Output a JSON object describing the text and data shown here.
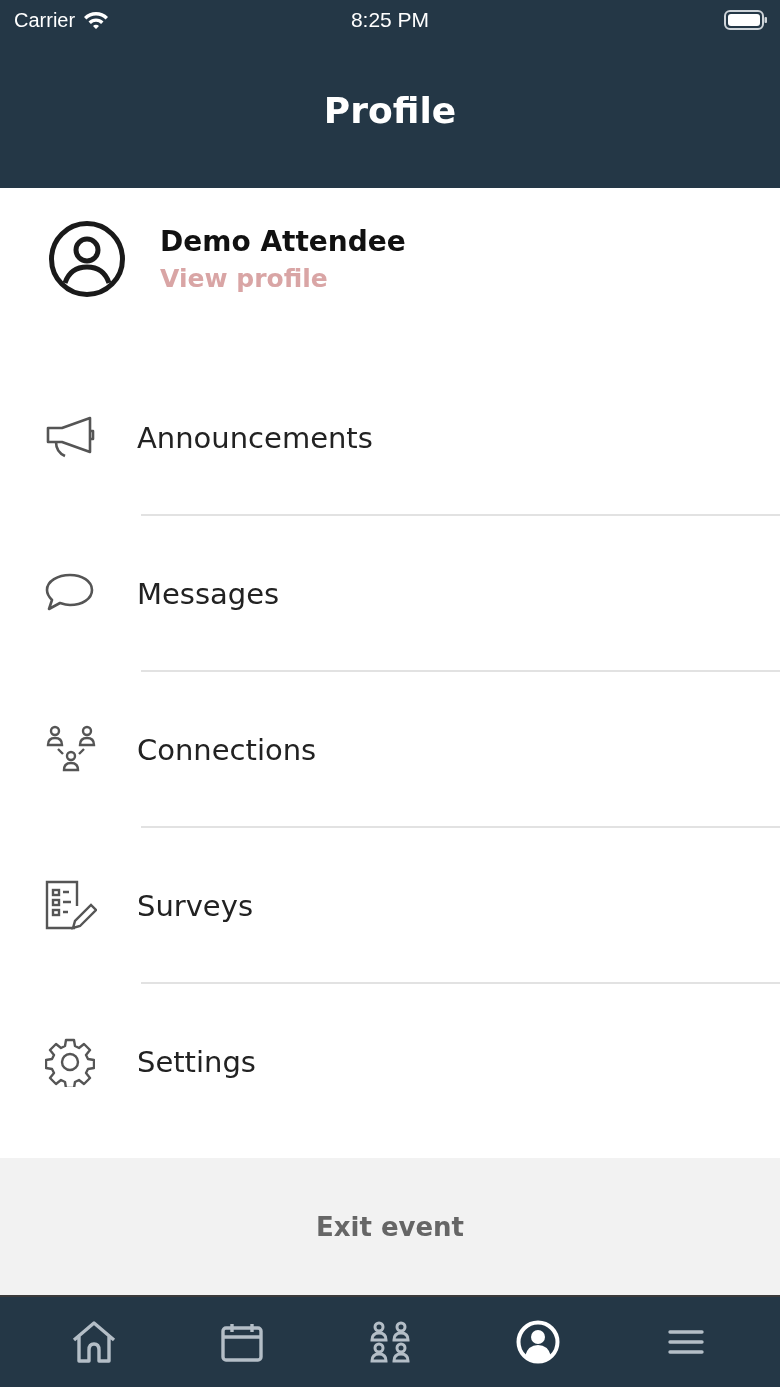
{
  "status_bar": {
    "carrier": "Carrier",
    "time": "8:25 PM"
  },
  "header": {
    "title": "Profile"
  },
  "profile": {
    "name": "Demo Attendee",
    "link": "View profile"
  },
  "menu": [
    {
      "kind": "announcements",
      "label": "Announcements"
    },
    {
      "kind": "messages",
      "label": "Messages"
    },
    {
      "kind": "connections",
      "label": "Connections"
    },
    {
      "kind": "surveys",
      "label": "Surveys"
    },
    {
      "kind": "settings",
      "label": "Settings"
    }
  ],
  "exit_button": "Exit event",
  "tab_bar": [
    {
      "kind": "home",
      "selected": false
    },
    {
      "kind": "calendar",
      "selected": false
    },
    {
      "kind": "people",
      "selected": false
    },
    {
      "kind": "profile",
      "selected": true
    },
    {
      "kind": "menu",
      "selected": false
    }
  ]
}
